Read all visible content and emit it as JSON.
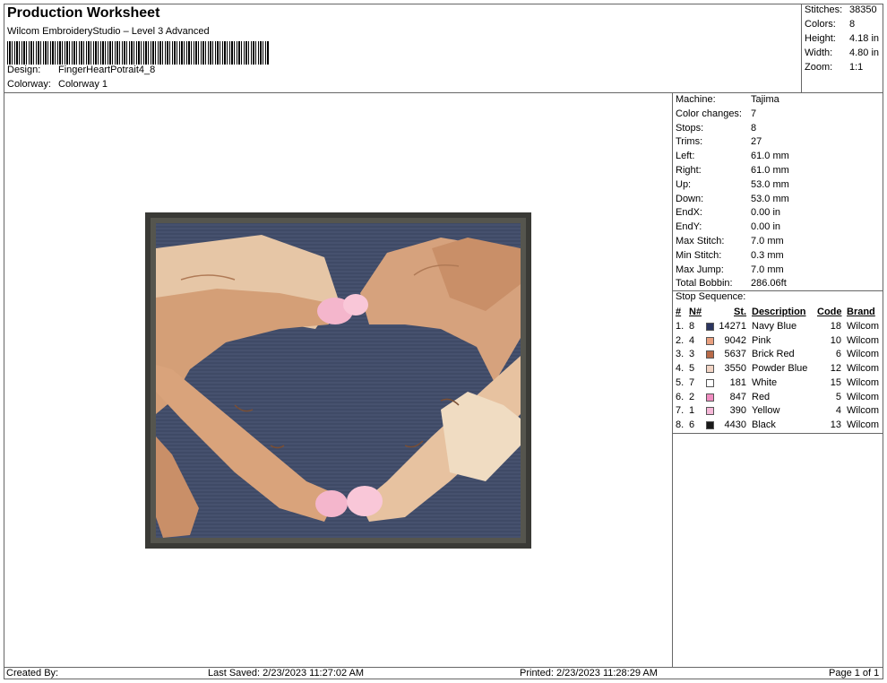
{
  "header": {
    "title": "Production Worksheet",
    "subtitle": "Wilcom EmbroideryStudio – Level 3 Advanced",
    "design_label": "Design:",
    "design_value": "FingerHeartPotrait4_8",
    "colorway_label": "Colorway:",
    "colorway_value": "Colorway 1"
  },
  "summary": {
    "stitches_label": "Stitches:",
    "stitches_value": "38350",
    "colors_label": "Colors:",
    "colors_value": "8",
    "height_label": "Height:",
    "height_value": "4.18 in",
    "width_label": "Width:",
    "width_value": "4.80 in",
    "zoom_label": "Zoom:",
    "zoom_value": "1:1"
  },
  "machine_info": [
    {
      "k": "Machine:",
      "v": "Tajima"
    },
    {
      "k": "Color changes:",
      "v": "7"
    },
    {
      "k": "Stops:",
      "v": "8"
    },
    {
      "k": "Trims:",
      "v": "27"
    },
    {
      "k": "Left:",
      "v": "61.0 mm"
    },
    {
      "k": "Right:",
      "v": "61.0 mm"
    },
    {
      "k": "Up:",
      "v": "53.0 mm"
    },
    {
      "k": "Down:",
      "v": "53.0 mm"
    },
    {
      "k": "EndX:",
      "v": "0.00 in"
    },
    {
      "k": "EndY:",
      "v": "0.00 in"
    },
    {
      "k": "Max Stitch:",
      "v": "7.0 mm"
    },
    {
      "k": "Min Stitch:",
      "v": "0.3 mm"
    },
    {
      "k": "Max Jump:",
      "v": "7.0 mm"
    },
    {
      "k": "Total Bobbin:",
      "v": "286.06ft"
    }
  ],
  "stop_sequence": {
    "title": "Stop Sequence:",
    "headers": {
      "num": "#",
      "n": "N#",
      "st": "St.",
      "desc": "Description",
      "code": "Code",
      "brand": "Brand"
    },
    "rows": [
      {
        "num": "1.",
        "n": "8",
        "color": "#2b3560",
        "st": "14271",
        "desc": "Navy Blue",
        "code": "18",
        "brand": "Wilcom"
      },
      {
        "num": "2.",
        "n": "4",
        "color": "#e9a07f",
        "st": "9042",
        "desc": "Pink",
        "code": "10",
        "brand": "Wilcom"
      },
      {
        "num": "3.",
        "n": "3",
        "color": "#b86a48",
        "st": "5637",
        "desc": "Brick Red",
        "code": "6",
        "brand": "Wilcom"
      },
      {
        "num": "4.",
        "n": "5",
        "color": "#f2d4c4",
        "st": "3550",
        "desc": "Powder Blue",
        "code": "12",
        "brand": "Wilcom"
      },
      {
        "num": "5.",
        "n": "7",
        "color": "#ffffff",
        "st": "181",
        "desc": "White",
        "code": "15",
        "brand": "Wilcom"
      },
      {
        "num": "6.",
        "n": "2",
        "color": "#f08cc0",
        "st": "847",
        "desc": "Red",
        "code": "5",
        "brand": "Wilcom"
      },
      {
        "num": "7.",
        "n": "1",
        "color": "#f6b8d8",
        "st": "390",
        "desc": "Yellow",
        "code": "4",
        "brand": "Wilcom"
      },
      {
        "num": "8.",
        "n": "6",
        "color": "#1a1a1a",
        "st": "4430",
        "desc": "Black",
        "code": "13",
        "brand": "Wilcom"
      }
    ]
  },
  "footer": {
    "created_by": "Created By:",
    "last_saved": "Last Saved: 2/23/2023 11:27:02 AM",
    "printed": "Printed: 2/23/2023 11:28:29 AM",
    "page": "Page 1 of 1"
  }
}
